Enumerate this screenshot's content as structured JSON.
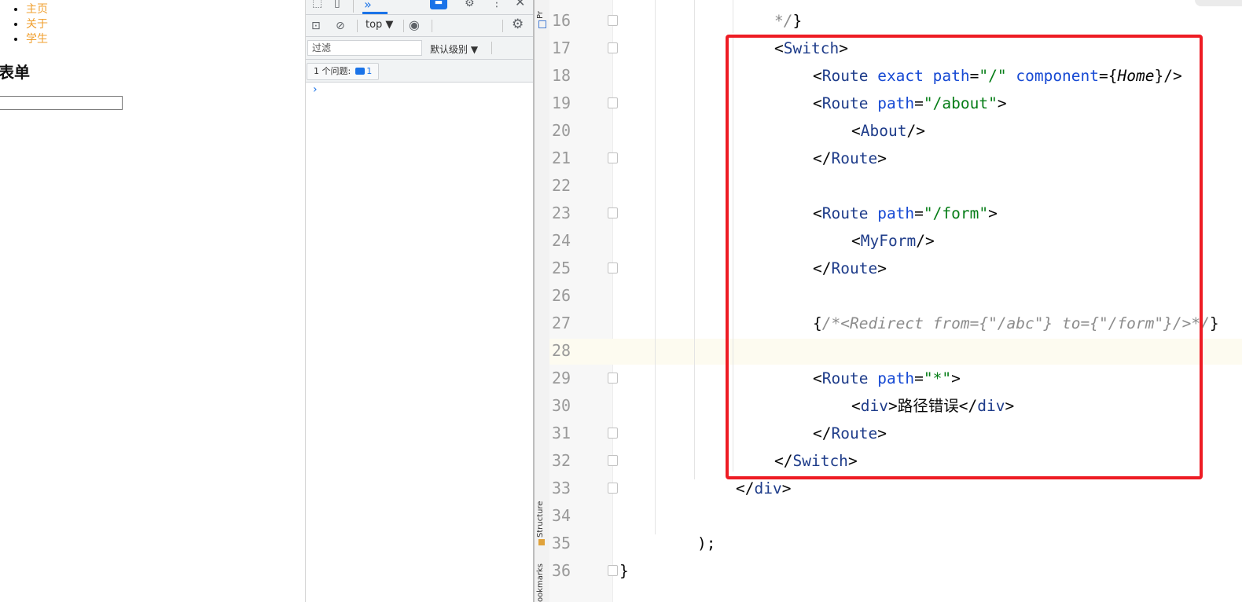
{
  "preview": {
    "nav_items": [
      "主页",
      "关于",
      "学生"
    ],
    "form_title": "表单"
  },
  "devtools": {
    "tab_more": "»",
    "context": "top ▼",
    "filter_placeholder": "过滤",
    "level_select": "默认级别 ▼",
    "issues_label": "1 个问题:",
    "issues_count": "1",
    "console_prompt": "›"
  },
  "ide": {
    "side_labels": [
      "Pr",
      "Structure",
      "ookmarks"
    ],
    "code_lines": [
      {
        "num": "16",
        "indent": 3,
        "fold": true
      },
      {
        "num": "17",
        "indent": 3,
        "fold": true
      },
      {
        "num": "18",
        "indent": 4,
        "fold": false
      },
      {
        "num": "19",
        "indent": 4,
        "fold": true
      },
      {
        "num": "20",
        "indent": 5,
        "fold": false
      },
      {
        "num": "21",
        "indent": 4,
        "fold": true
      },
      {
        "num": "22",
        "indent": 0,
        "fold": false
      },
      {
        "num": "23",
        "indent": 4,
        "fold": true
      },
      {
        "num": "24",
        "indent": 5,
        "fold": false
      },
      {
        "num": "25",
        "indent": 4,
        "fold": true
      },
      {
        "num": "26",
        "indent": 0,
        "fold": false
      },
      {
        "num": "27",
        "indent": 4,
        "fold": false
      },
      {
        "num": "28",
        "indent": 0,
        "fold": false
      },
      {
        "num": "29",
        "indent": 4,
        "fold": true
      },
      {
        "num": "30",
        "indent": 5,
        "fold": false
      },
      {
        "num": "31",
        "indent": 4,
        "fold": true
      },
      {
        "num": "32",
        "indent": 3,
        "fold": true
      },
      {
        "num": "33",
        "indent": 2,
        "fold": true
      },
      {
        "num": "34",
        "indent": 0,
        "fold": false
      },
      {
        "num": "35",
        "indent": 1,
        "fold": false
      },
      {
        "num": "36",
        "indent": 0,
        "fold": true
      }
    ],
    "code_tokens": [
      [
        [
          "cmt",
          "*/"
        ],
        [
          "plain",
          "}"
        ]
      ],
      [
        [
          "plain",
          "<"
        ],
        [
          "tag",
          "Switch"
        ],
        [
          "plain",
          ">"
        ]
      ],
      [
        [
          "plain",
          "<"
        ],
        [
          "tag",
          "Route"
        ],
        [
          "plain",
          " "
        ],
        [
          "attr",
          "exact"
        ],
        [
          "plain",
          " "
        ],
        [
          "attr",
          "path"
        ],
        [
          "plain",
          "="
        ],
        [
          "str",
          "\"/\""
        ],
        [
          "plain",
          " "
        ],
        [
          "attr",
          "component"
        ],
        [
          "plain",
          "={"
        ],
        [
          "comp",
          "Home"
        ],
        [
          "plain",
          "}/>"
        ]
      ],
      [
        [
          "plain",
          "<"
        ],
        [
          "tag",
          "Route"
        ],
        [
          "plain",
          " "
        ],
        [
          "attr",
          "path"
        ],
        [
          "plain",
          "="
        ],
        [
          "str",
          "\"/about\""
        ],
        [
          "plain",
          ">"
        ]
      ],
      [
        [
          "plain",
          "<"
        ],
        [
          "tag",
          "About"
        ],
        [
          "plain",
          "/>"
        ]
      ],
      [
        [
          "plain",
          "</"
        ],
        [
          "tag",
          "Route"
        ],
        [
          "plain",
          ">"
        ]
      ],
      [],
      [
        [
          "plain",
          "<"
        ],
        [
          "tag",
          "Route"
        ],
        [
          "plain",
          " "
        ],
        [
          "attr",
          "path"
        ],
        [
          "plain",
          "="
        ],
        [
          "str",
          "\"/form\""
        ],
        [
          "plain",
          ">"
        ]
      ],
      [
        [
          "plain",
          "<"
        ],
        [
          "tag",
          "MyForm"
        ],
        [
          "plain",
          "/>"
        ]
      ],
      [
        [
          "plain",
          "</"
        ],
        [
          "tag",
          "Route"
        ],
        [
          "plain",
          ">"
        ]
      ],
      [],
      [
        [
          "plain",
          "{"
        ],
        [
          "cmt",
          "/*<Redirect from={\"/abc\"} to={\"/form\"}/>*/"
        ],
        [
          "plain",
          "}"
        ]
      ],
      [],
      [
        [
          "plain",
          "<"
        ],
        [
          "tag",
          "Route"
        ],
        [
          "plain",
          " "
        ],
        [
          "attr",
          "path"
        ],
        [
          "plain",
          "="
        ],
        [
          "str",
          "\"*\""
        ],
        [
          "plain",
          ">"
        ]
      ],
      [
        [
          "plain",
          "<"
        ],
        [
          "tag",
          "div"
        ],
        [
          "plain",
          ">路径错误</"
        ],
        [
          "tag",
          "div"
        ],
        [
          "plain",
          ">"
        ]
      ],
      [
        [
          "plain",
          "</"
        ],
        [
          "tag",
          "Route"
        ],
        [
          "plain",
          ">"
        ]
      ],
      [
        [
          "plain",
          "</"
        ],
        [
          "tag",
          "Switch"
        ],
        [
          "plain",
          ">"
        ]
      ],
      [
        [
          "plain",
          "</"
        ],
        [
          "tag",
          "div"
        ],
        [
          "plain",
          ">"
        ]
      ],
      [],
      [
        [
          "plain",
          ");"
        ]
      ],
      [
        [
          "plain",
          "}"
        ]
      ]
    ]
  }
}
